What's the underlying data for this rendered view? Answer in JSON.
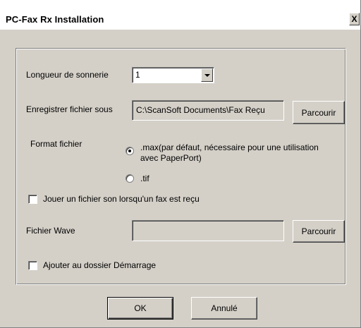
{
  "window": {
    "title": "PC-Fax Rx Installation",
    "close_glyph": "X"
  },
  "ring_length": {
    "label": "Longueur de sonnerie",
    "value": "1"
  },
  "save_file": {
    "label": "Enregistrer fichier sous",
    "path": "C:\\ScanSoft Documents\\Fax Reçu",
    "browse_label": "Parcourir"
  },
  "file_format": {
    "label": "Format fichier",
    "options": [
      {
        "line1": ".max(par défaut, nécessaire pour une utilisation",
        "line2": "avec PaperPort)",
        "checked": true
      },
      {
        "line1": ".tif",
        "checked": false
      }
    ]
  },
  "play_sound": {
    "label": "Jouer un fichier son lorsqu'un fax est reçu",
    "checked": false
  },
  "wave_file": {
    "label": "Fichier Wave",
    "value": "",
    "browse_label": "Parcourir"
  },
  "add_startup": {
    "label": "Ajouter au dossier Démarrage",
    "checked": false
  },
  "footer": {
    "ok_label": "OK",
    "cancel_label": "Annulé"
  },
  "colors": {
    "dialog_face": "#d4d0c8",
    "titlebar": "#ffffff"
  }
}
